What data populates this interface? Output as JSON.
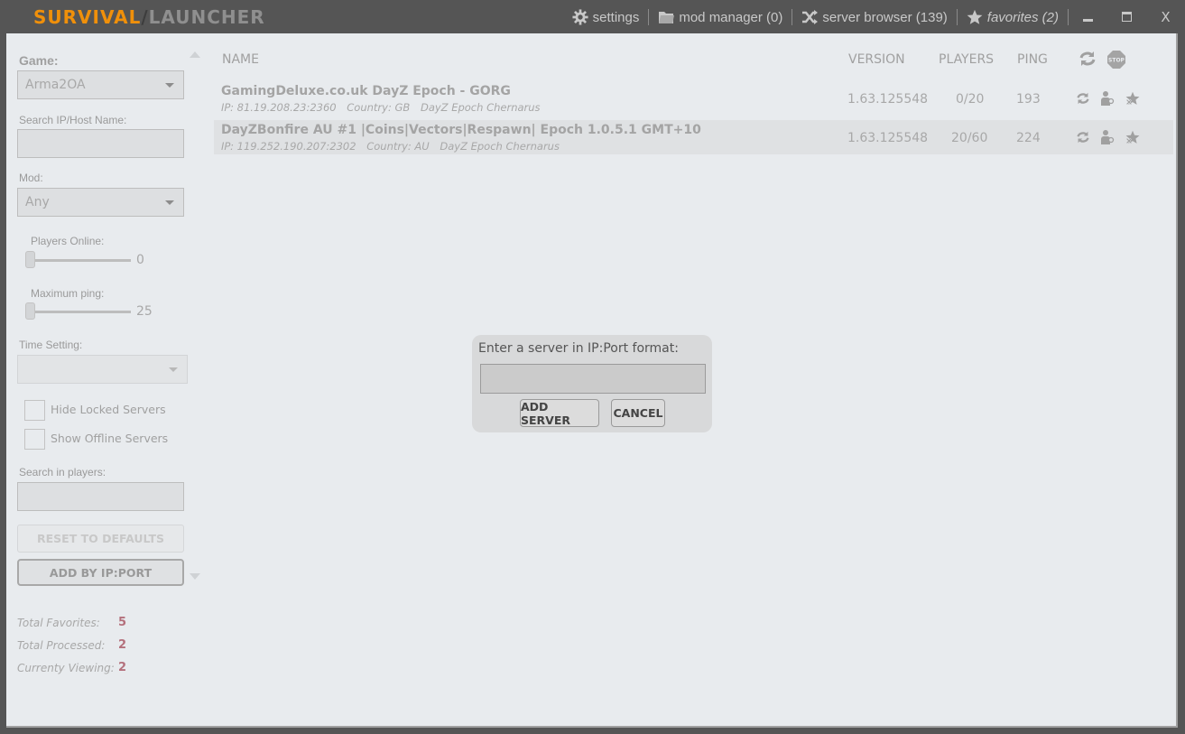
{
  "app": {
    "logo_part1": "SURVIVAL",
    "logo_sep": "/",
    "logo_part2": "LAUNCHER"
  },
  "nav": {
    "settings": "settings",
    "mod_manager": "mod manager (0)",
    "server_browser": "server browser (139)",
    "favorites": "favorites (2)",
    "minimize": "–",
    "maximize": "▭",
    "close": "X"
  },
  "sidebar": {
    "game_label": "Game:",
    "game_value": "Arma2OA",
    "search_label": "Search IP/Host Name:",
    "search_value": "",
    "mod_label": "Mod:",
    "mod_value": "Any",
    "players_online_label": "Players Online:",
    "players_online_value": "0",
    "max_ping_label": "Maximum ping:",
    "max_ping_value": "25",
    "time_setting_label": "Time Setting:",
    "time_setting_value": "",
    "hide_locked_label": "Hide Locked Servers",
    "hide_locked_checked": false,
    "show_offline_label": "Show Offline Servers",
    "show_offline_checked": false,
    "search_players_label": "Search in players:",
    "search_players_value": "",
    "reset_button": "RESET TO DEFAULTS",
    "add_ip_button": "ADD BY IP:PORT",
    "stats": [
      {
        "label": "Total Favorites:",
        "value": "5"
      },
      {
        "label": "Total Processed:",
        "value": "2"
      },
      {
        "label": "Currenty Viewing:",
        "value": "2"
      }
    ]
  },
  "table": {
    "columns": {
      "name": "NAME",
      "version": "VERSION",
      "players": "PLAYERS",
      "ping": "PING"
    },
    "rows": [
      {
        "name": "GamingDeluxe.co.uk DayZ Epoch - GORG",
        "ip": "IP: 81.19.208.23:2360",
        "country": "Country: GB",
        "map": "DayZ Epoch Chernarus",
        "version": "1.63.125548",
        "players": "0/20",
        "ping": "193"
      },
      {
        "name": "DayZBonfire AU #1 |Coins|Vectors|Respawn| Epoch 1.0.5.1 GMT+10",
        "ip": "IP: 119.252.190.207:2302",
        "country": "Country: AU",
        "map": "DayZ Epoch Chernarus",
        "version": "1.63.125548",
        "players": "20/60",
        "ping": "224"
      }
    ]
  },
  "dialog": {
    "label": "Enter a server in IP:Port format:",
    "input_value": "",
    "add_button": "ADD SERVER",
    "cancel_button": "CANCEL"
  }
}
